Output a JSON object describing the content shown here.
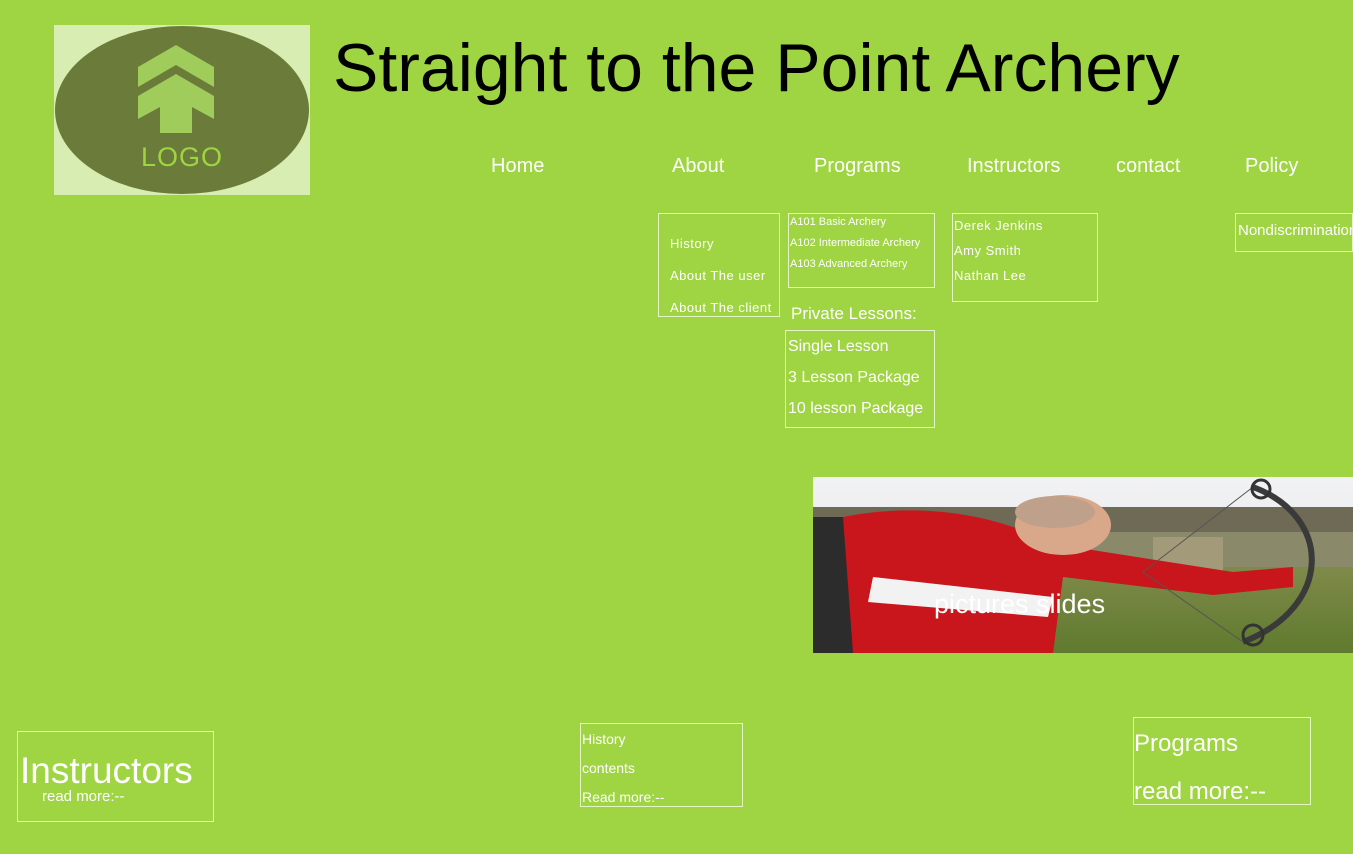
{
  "logo": {
    "text": "LOGO"
  },
  "site_title": "Straight to the Point Archery",
  "nav": {
    "home": "Home",
    "about": "About",
    "programs": "Programs",
    "instructors": "Instructors",
    "contact": "contact",
    "policy": "Policy"
  },
  "about_menu": [
    "History",
    "About The user",
    "About The client"
  ],
  "programs_menu": [
    "A101 Basic Archery",
    "A102 Intermediate Archery",
    "A103 Advanced Archery"
  ],
  "private_lessons": {
    "heading": "Private Lessons:",
    "items": [
      "Single Lesson",
      "3 Lesson Package",
      "10 lesson Package"
    ]
  },
  "instructors_menu": [
    "Derek Jenkins",
    "Amy Smith",
    "Nathan Lee"
  ],
  "policy_menu": [
    "Nondiscrimination"
  ],
  "slideshow": {
    "caption": "pictures slides"
  },
  "cards": {
    "instructors": {
      "title": "Instructors",
      "link": "read more:--"
    },
    "history": {
      "title": "History",
      "body": "contents",
      "link": "Read more:--"
    },
    "programs": {
      "title": "Programs",
      "link": "read more:--"
    }
  },
  "colors": {
    "background": "#9fd442",
    "logo_box": "#d8edb2",
    "logo_ellipse": "#6b7c3a",
    "logo_arrow": "#9fcc5a",
    "text_light": "#ffffff"
  }
}
